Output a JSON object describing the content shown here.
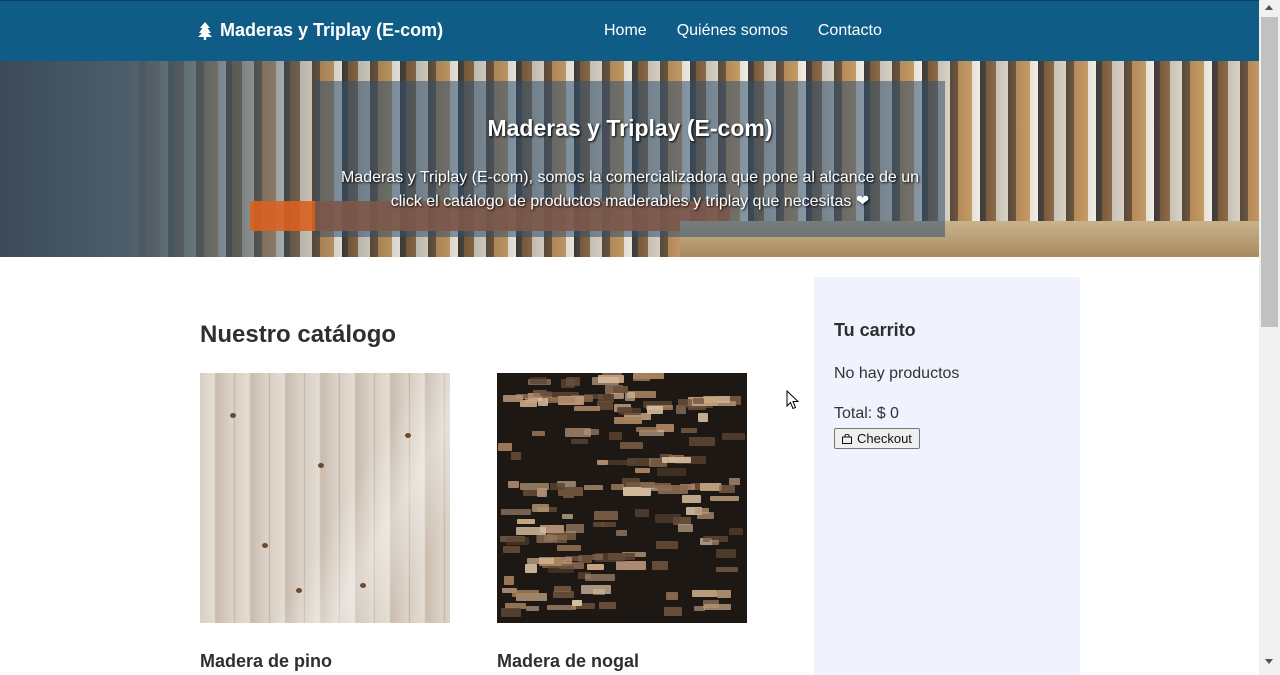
{
  "navbar": {
    "brand": "Maderas y Triplay (E-com)",
    "brand_icon": "tree-icon",
    "links": [
      "Home",
      "Quiénes somos",
      "Contacto"
    ],
    "color": "#0f5c86"
  },
  "hero": {
    "title": "Maderas y Triplay (E-com)",
    "text": "Maderas y Triplay (E-com), somos la comercializadora que pone al alcance de un click el catálogo de productos maderables y triplay que necesitas ❤︎"
  },
  "catalog": {
    "title": "Nuestro catálogo",
    "products": [
      {
        "name": "Madera de pino"
      },
      {
        "name": "Madera de nogal"
      }
    ]
  },
  "cart": {
    "title": "Tu carrito",
    "empty_text": "No hay productos",
    "total_text": "Total: $ 0",
    "checkout_label": "Checkout",
    "background": "#f0f2fe"
  }
}
